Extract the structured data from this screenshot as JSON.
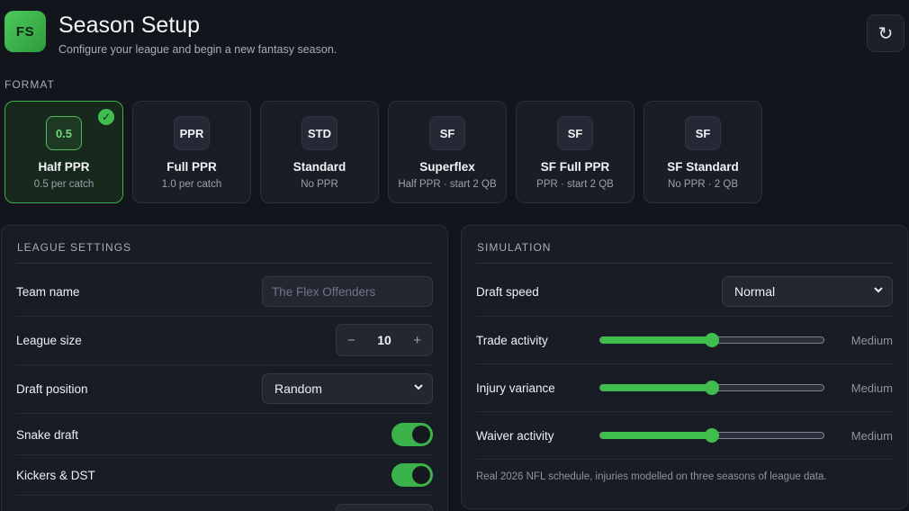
{
  "header": {
    "logo_text": "FS",
    "title": "Season Setup",
    "subtitle": "Configure your league and begin a new fantasy season.",
    "refresh_icon": "↻"
  },
  "format": {
    "label": "FORMAT",
    "options": [
      {
        "badge": "0.5",
        "name": "Half PPR",
        "desc": "0.5 per catch",
        "selected": true
      },
      {
        "badge": "PPR",
        "name": "Full PPR",
        "desc": "1.0 per catch",
        "selected": false
      },
      {
        "badge": "STD",
        "name": "Standard",
        "desc": "No PPR",
        "selected": false
      },
      {
        "badge": "SF",
        "name": "Superflex",
        "desc": "Half PPR · start 2 QB",
        "selected": false
      },
      {
        "badge": "SF",
        "name": "SF Full PPR",
        "desc": "PPR · start 2 QB",
        "selected": false
      },
      {
        "badge": "SF",
        "name": "SF Standard",
        "desc": "No PPR · 2 QB",
        "selected": false
      }
    ],
    "check_glyph": "✓"
  },
  "league": {
    "title": "LEAGUE SETTINGS",
    "team_name_label": "Team name",
    "team_name_placeholder": "The Flex Offenders",
    "league_size_label": "League size",
    "league_size_value": "10",
    "minus": "−",
    "plus": "+",
    "draft_position_label": "Draft position",
    "draft_position_value": "Random",
    "snake_draft_label": "Snake draft",
    "snake_draft_on": true,
    "kickers_label": "Kickers & DST",
    "kickers_on": true
  },
  "simulation": {
    "title": "SIMULATION",
    "draft_speed_label": "Draft speed",
    "draft_speed_value": "Normal",
    "sliders": [
      {
        "label": "Trade activity",
        "value_text": "Medium",
        "level": 0.5
      },
      {
        "label": "Injury variance",
        "value_text": "Medium",
        "level": 0.5
      },
      {
        "label": "Waiver activity",
        "value_text": "Medium",
        "level": 0.5
      }
    ],
    "footnote": "Real 2026 NFL schedule, injuries modelled on three seasons of league data."
  },
  "colors": {
    "accent": "#3fbe4e",
    "background": "#12151b",
    "panel": "#181c24"
  }
}
